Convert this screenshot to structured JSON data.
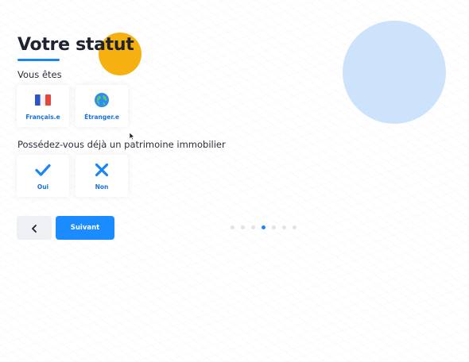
{
  "page": {
    "title": "Votre statut"
  },
  "nationality": {
    "question": "Vous êtes",
    "options": [
      {
        "label": "Français.e",
        "icon": "france-flag-icon"
      },
      {
        "label": "Étranger.e",
        "icon": "globe-icon"
      }
    ]
  },
  "property": {
    "question": "Possédez-vous déjà un patrimoine immobilier",
    "options": [
      {
        "label": "Oui",
        "icon": "check-icon"
      },
      {
        "label": "Non",
        "icon": "close-icon"
      }
    ]
  },
  "navigation": {
    "back_icon": "chevron-left-icon",
    "next_label": "Suivant",
    "steps_total": 7,
    "current_step": 4
  },
  "colors": {
    "accent": "#1a8cff",
    "decor_yellow": "#f6b00f",
    "decor_blue": "#cde3fb",
    "title": "#1f2230",
    "option_text": "#1a73d9"
  }
}
